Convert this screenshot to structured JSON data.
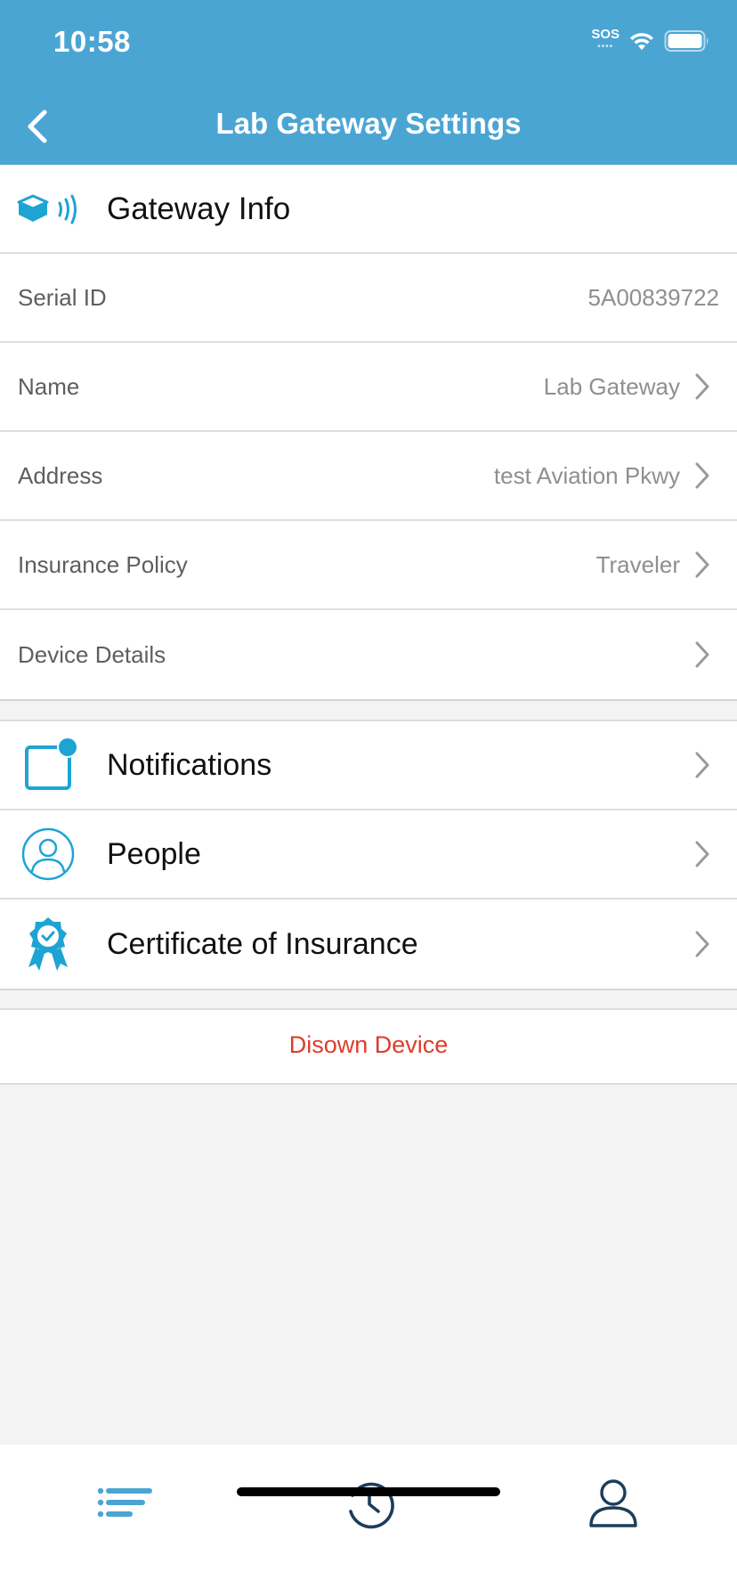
{
  "status_bar": {
    "time": "10:58",
    "sos": "SOS"
  },
  "nav": {
    "title": "Lab Gateway Settings"
  },
  "gateway_section": {
    "title": "Gateway Info",
    "rows": [
      {
        "label": "Serial ID",
        "value": "5A00839722"
      },
      {
        "label": "Name",
        "value": "Lab Gateway"
      },
      {
        "label": "Address",
        "value": "test Aviation Pkwy"
      },
      {
        "label": "Insurance Policy",
        "value": "Traveler"
      },
      {
        "label": "Device Details",
        "value": ""
      }
    ]
  },
  "menu": {
    "items": [
      {
        "label": "Notifications",
        "icon": "notification-icon"
      },
      {
        "label": "People",
        "icon": "person-circle-icon"
      },
      {
        "label": "Certificate of Insurance",
        "icon": "award-ribbon-icon"
      }
    ]
  },
  "actions": {
    "disown": "Disown Device"
  },
  "tabbar": {
    "tabs": [
      {
        "icon": "list-icon"
      },
      {
        "icon": "history-icon"
      },
      {
        "icon": "profile-icon"
      }
    ]
  },
  "colors": {
    "header": "#4ba5d3",
    "accent": "#1ea4d3",
    "danger": "#dc3d2a",
    "tab_icon": "#1c3d5a"
  }
}
